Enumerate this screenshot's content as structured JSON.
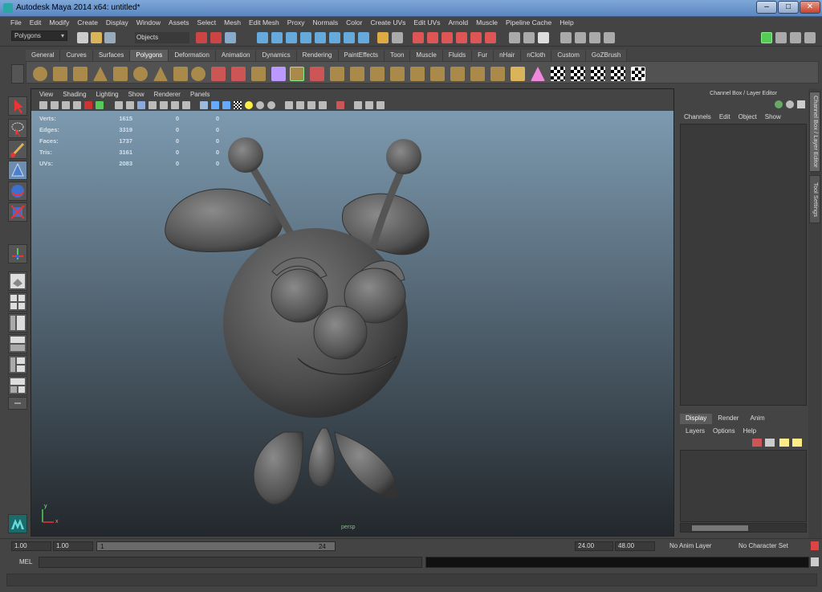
{
  "window": {
    "title": "Autodesk Maya 2014 x64: untitled*"
  },
  "menubar": [
    "File",
    "Edit",
    "Modify",
    "Create",
    "Display",
    "Window",
    "Assets",
    "Select",
    "Mesh",
    "Edit Mesh",
    "Proxy",
    "Normals",
    "Color",
    "Create UVs",
    "Edit UVs",
    "Arnold",
    "Muscle",
    "Pipeline Cache",
    "Help"
  ],
  "statusline": {
    "mode": "Polygons",
    "selection_field": "Objects"
  },
  "shelf": {
    "tabs": [
      "General",
      "Curves",
      "Surfaces",
      "Polygons",
      "Deformation",
      "Animation",
      "Dynamics",
      "Rendering",
      "PaintEffects",
      "Toon",
      "Muscle",
      "Fluids",
      "Fur",
      "nHair",
      "nCloth",
      "Custom",
      "GoZBrush"
    ],
    "active_tab": "Polygons"
  },
  "viewport": {
    "menu": [
      "View",
      "Shading",
      "Lighting",
      "Show",
      "Renderer",
      "Panels"
    ],
    "camera_label": "persp",
    "hud": [
      {
        "label": "Verts:",
        "v1": "1615",
        "v2": "0",
        "v3": "0"
      },
      {
        "label": "Edges:",
        "v1": "3319",
        "v2": "0",
        "v3": "0"
      },
      {
        "label": "Faces:",
        "v1": "1737",
        "v2": "0",
        "v3": "0"
      },
      {
        "label": "Tris:",
        "v1": "3161",
        "v2": "0",
        "v3": "0"
      },
      {
        "label": "UVs:",
        "v1": "2083",
        "v2": "0",
        "v3": "0"
      }
    ],
    "axis": {
      "x": "x",
      "y": "y"
    }
  },
  "channel_box": {
    "title": "Channel Box / Layer Editor",
    "menu": [
      "Channels",
      "Edit",
      "Object",
      "Show"
    ]
  },
  "layer_editor": {
    "tabs": [
      "Display",
      "Render",
      "Anim"
    ],
    "active_tab": "Display",
    "menu": [
      "Layers",
      "Options",
      "Help"
    ]
  },
  "side_tabs": [
    "Channel Box / Layer Editor",
    "Tool Settings"
  ],
  "range": {
    "start_time": "1.00",
    "playback_start": "1.00",
    "range_low": "1",
    "range_high": "24",
    "playback_end": "24.00",
    "end_time": "48.00",
    "anim_layer": "No Anim Layer",
    "character_set": "No Character Set"
  },
  "command_line": {
    "label": "MEL"
  }
}
